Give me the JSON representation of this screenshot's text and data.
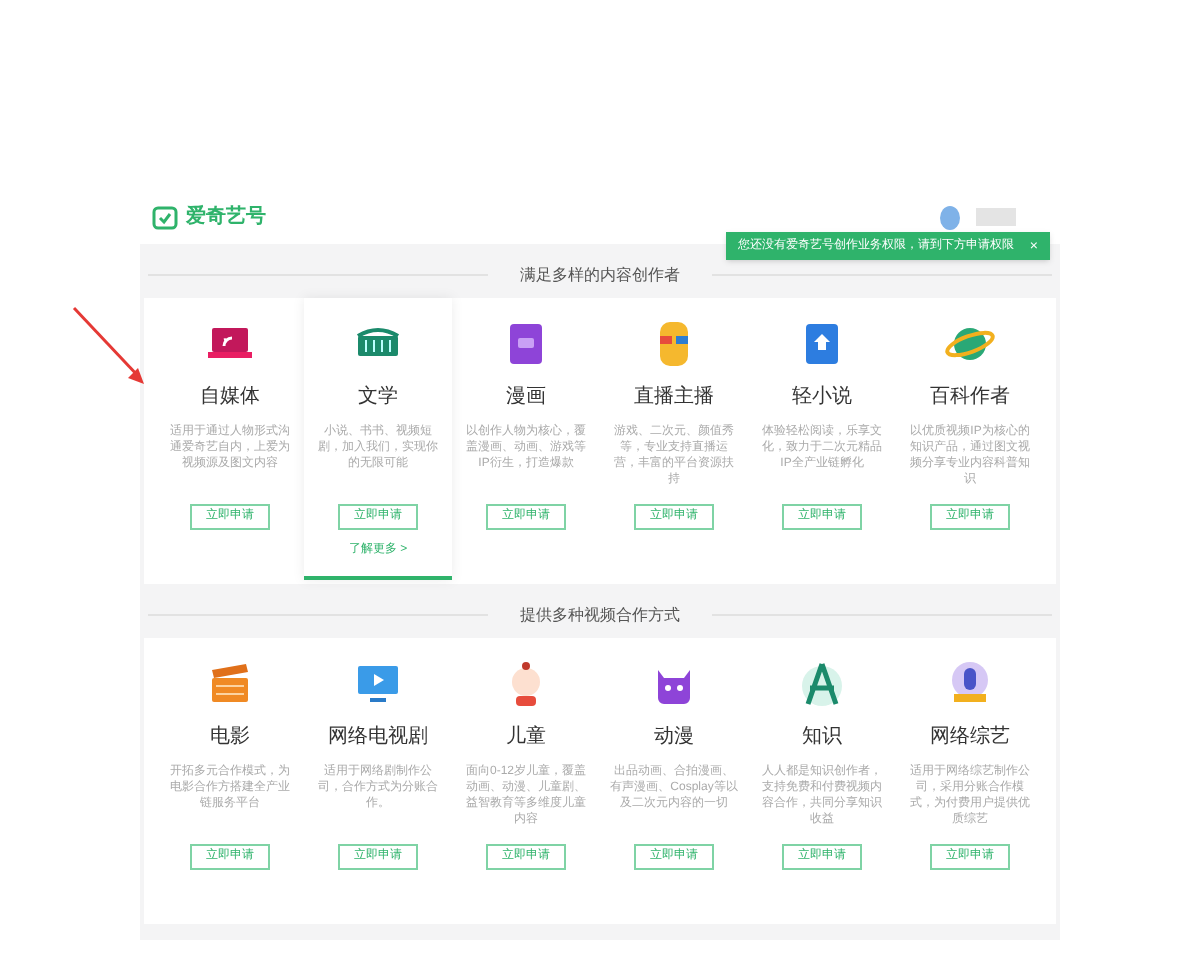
{
  "header": {
    "logo": "爱奇艺号",
    "tooltip": {
      "text": "您还没有爱奇艺号创作业务权限，请到下方申请权限",
      "close": "×"
    }
  },
  "sections": [
    {
      "title": "满足多样的内容创作者",
      "items": [
        {
          "name": "自媒体",
          "desc": "适用于通过人物形式沟通爱奇艺自内，上爱为视频源及图文内容",
          "button": "立即申请",
          "selected": false
        },
        {
          "name": "文学",
          "desc": "小说、书书、视频短剧，加入我们，实现你的无限可能",
          "button": "立即申请",
          "selected": true,
          "more": "了解更多 >"
        },
        {
          "name": "漫画",
          "desc": "以创作人物为核心，覆盖漫画、动画、游戏等IP衍生，打造爆款",
          "button": "立即申请",
          "selected": false
        },
        {
          "name": "直播主播",
          "desc": "游戏、二次元、颜值秀等，专业支持直播运营，丰富的平台资源扶持",
          "button": "立即申请",
          "selected": false
        },
        {
          "name": "轻小说",
          "desc": "体验轻松阅读，乐享文化，致力于二次元精品IP全产业链孵化",
          "button": "立即申请",
          "selected": false
        },
        {
          "name": "百科作者",
          "desc": "以优质视频IP为核心的知识产品，通过图文视频分享专业内容科普知识",
          "button": "立即申请",
          "selected": false
        }
      ]
    },
    {
      "title": "提供多种视频合作方式",
      "items": [
        {
          "name": "电影",
          "desc": "开拓多元合作模式，为电影合作方搭建全产业链服务平台",
          "button": "立即申请",
          "selected": false
        },
        {
          "name": "网络电视剧",
          "desc": "适用于网络剧制作公司，合作方式为分账合作。",
          "button": "立即申请",
          "selected": false
        },
        {
          "name": "儿童",
          "desc": "面向0-12岁儿童，覆盖动画、动漫、儿童剧、益智教育等多维度儿童内容",
          "button": "立即申请",
          "selected": false
        },
        {
          "name": "动漫",
          "desc": "出品动画、合拍漫画、有声漫画、Cosplay等以及二次元内容的一切",
          "button": "立即申请",
          "selected": false
        },
        {
          "name": "知识",
          "desc": "人人都是知识创作者，支持免费和付费视频内容合作，共同分享知识收益",
          "button": "立即申请",
          "selected": false
        },
        {
          "name": "网络综艺",
          "desc": "适用于网络综艺制作公司，采用分账合作模式，为付费用户提供优质综艺",
          "button": "立即申请",
          "selected": false
        }
      ]
    }
  ]
}
